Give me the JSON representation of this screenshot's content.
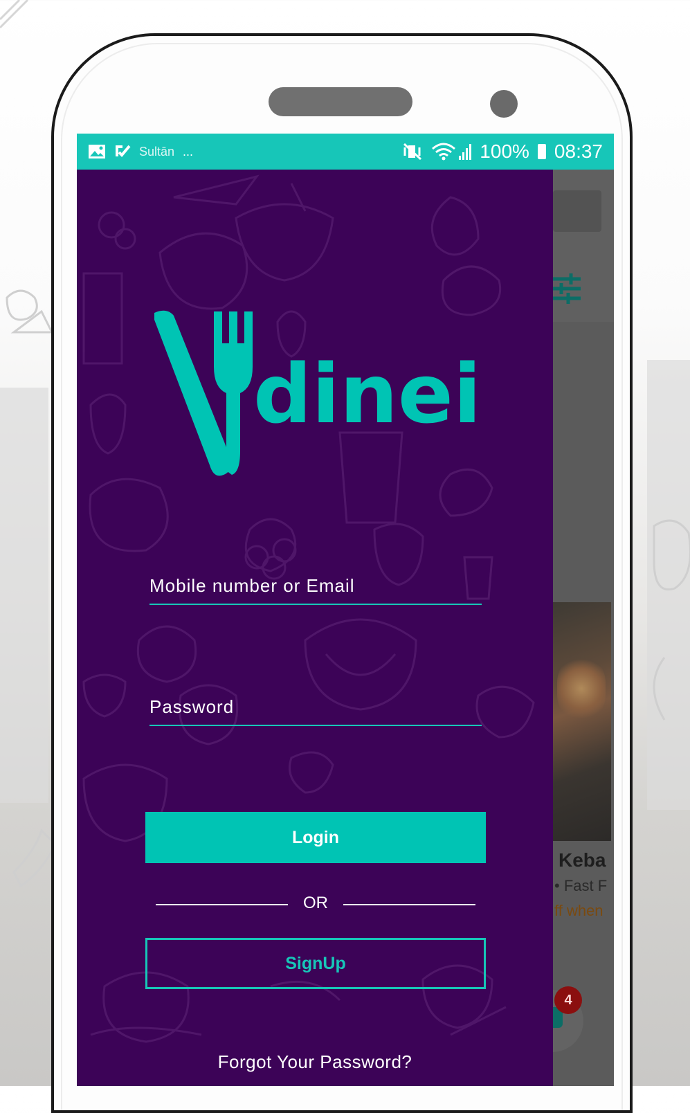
{
  "status_bar": {
    "left_icons": [
      "image-icon",
      "check-icon"
    ],
    "left_text": "Sultān",
    "more": "...",
    "battery": "100%",
    "time": "08:37"
  },
  "login": {
    "logo_text": "dinein",
    "username_placeholder": "Mobile number or Email",
    "password_placeholder": "Password",
    "login_label": "Login",
    "or_label": "OR",
    "signup_label": "SignUp",
    "forgot_label": "Forgot Your Password?"
  },
  "background_app": {
    "card_title": "Keba",
    "card_category": "Fast F",
    "card_offer": "ff when",
    "cart_badge": "4"
  },
  "colors": {
    "accent": "#00c4b4",
    "drawer_bg": "#3c0357",
    "status_bar": "#17c6b8",
    "badge": "#8b0f0f"
  }
}
